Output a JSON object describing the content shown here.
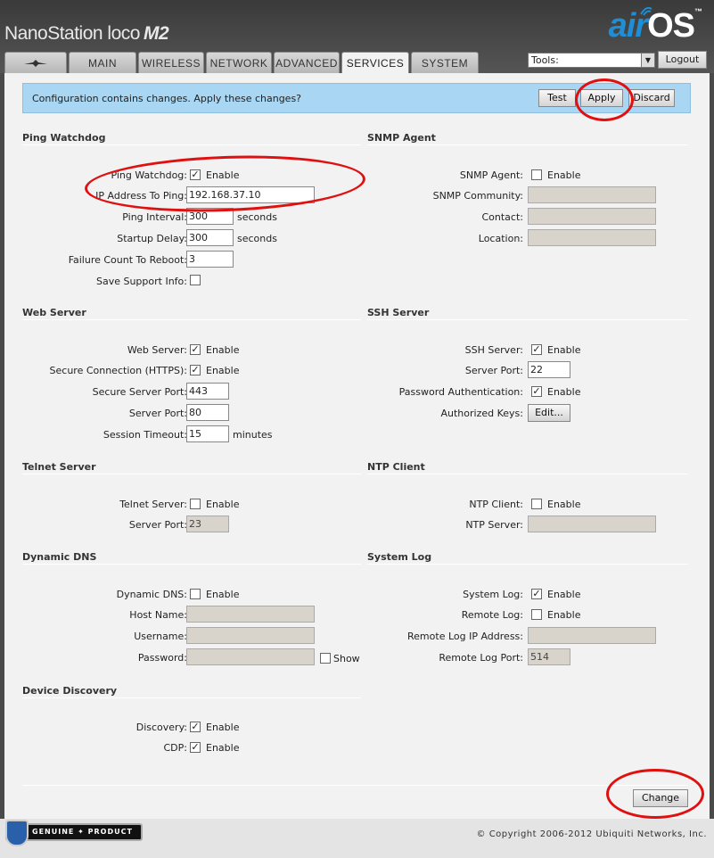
{
  "header": {
    "brand": "NanoStation loco",
    "model": "M2",
    "logo_air": "air",
    "logo_os": "OS",
    "logo_tm": "™",
    "tabs": [
      {
        "label": "",
        "icon": "ubiquiti-logo-icon"
      },
      {
        "label": "MAIN"
      },
      {
        "label": "WIRELESS"
      },
      {
        "label": "NETWORK"
      },
      {
        "label": "ADVANCED"
      },
      {
        "label": "SERVICES",
        "active": true
      },
      {
        "label": "SYSTEM"
      }
    ],
    "tools_value": "Tools:",
    "logout_label": "Logout"
  },
  "notice": {
    "text": "Configuration contains changes. Apply these changes?",
    "test": "Test",
    "apply": "Apply",
    "discard": "Discard"
  },
  "ping": {
    "title": "Ping Watchdog",
    "enabled_label": "Ping Watchdog:",
    "enabled_text": "Enable",
    "ip_label": "IP Address To Ping:",
    "ip": "192.168.37.10",
    "interval_label": "Ping Interval:",
    "interval": "300",
    "delay_label": "Startup Delay:",
    "delay": "300",
    "seconds": "seconds",
    "failure_label": "Failure Count To Reboot:",
    "failure": "3",
    "support_label": "Save Support Info:"
  },
  "snmp": {
    "title": "SNMP Agent",
    "agent_label": "SNMP Agent:",
    "enable": "Enable",
    "community_label": "SNMP Community:",
    "contact_label": "Contact:",
    "location_label": "Location:"
  },
  "web": {
    "title": "Web Server",
    "server_label": "Web Server:",
    "enable": "Enable",
    "https_label": "Secure Connection (HTTPS):",
    "secure_port_label": "Secure Server Port:",
    "secure_port": "443",
    "port_label": "Server Port:",
    "port": "80",
    "timeout_label": "Session Timeout:",
    "timeout": "15",
    "minutes": "minutes"
  },
  "ssh": {
    "title": "SSH Server",
    "server_label": "SSH Server:",
    "enable": "Enable",
    "port_label": "Server Port:",
    "port": "22",
    "pwauth_label": "Password Authentication:",
    "keys_label": "Authorized Keys:",
    "edit": "Edit..."
  },
  "telnet": {
    "title": "Telnet Server",
    "server_label": "Telnet Server:",
    "enable": "Enable",
    "port_label": "Server Port:",
    "port": "23"
  },
  "ntp": {
    "title": "NTP Client",
    "client_label": "NTP Client:",
    "enable": "Enable",
    "server_label": "NTP Server:"
  },
  "ddns": {
    "title": "Dynamic DNS",
    "ddns_label": "Dynamic DNS:",
    "enable": "Enable",
    "host_label": "Host Name:",
    "user_label": "Username:",
    "pass_label": "Password:",
    "show": "Show"
  },
  "syslog": {
    "title": "System Log",
    "log_label": "System Log:",
    "enable": "Enable",
    "remote_label": "Remote Log:",
    "remote_ip_label": "Remote Log IP Address:",
    "remote_port_label": "Remote Log Port:",
    "remote_port": "514"
  },
  "discovery": {
    "title": "Device Discovery",
    "discovery_label": "Discovery:",
    "enable": "Enable",
    "cdp_label": "CDP:"
  },
  "change_label": "Change",
  "footer": {
    "genuine": "GENUINE",
    "product": "PRODUCT",
    "copyright": "© Copyright 2006-2012 Ubiquiti Networks, Inc."
  },
  "colors": {
    "notice_bg": "#a9d6f2",
    "annotation_red": "#e01010",
    "logo_blue": "#1e8fd6"
  }
}
